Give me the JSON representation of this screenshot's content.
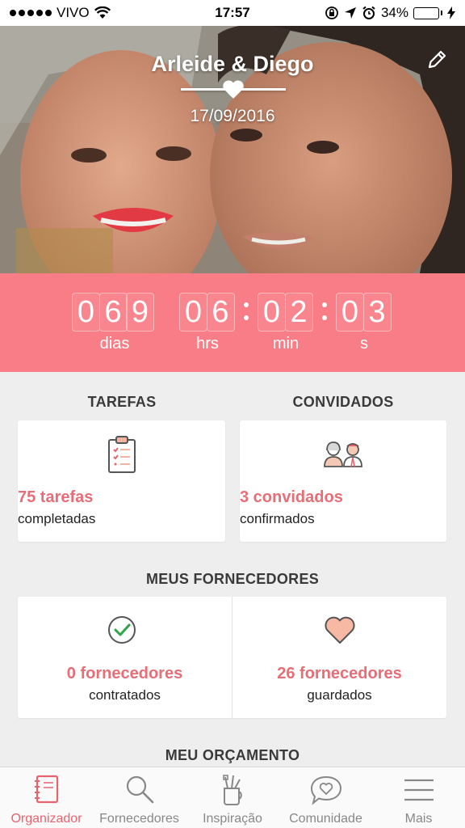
{
  "status_bar": {
    "carrier": "VIVO",
    "time": "17:57",
    "battery_percent": "34%",
    "battery_level": 0.34
  },
  "hero": {
    "title": "Arleide & Diego",
    "date": "17/09/2016"
  },
  "countdown": {
    "days_digits": [
      "0",
      "6",
      "9"
    ],
    "hours_digits": [
      "0",
      "6"
    ],
    "minutes_digits": [
      "0",
      "2"
    ],
    "seconds_digits": [
      "0",
      "3"
    ],
    "days_label": "dias",
    "hours_label": "hrs",
    "minutes_label": "min",
    "seconds_label": "s"
  },
  "tasks": {
    "title": "TAREFAS",
    "value": "75 tarefas",
    "sub": "completadas"
  },
  "guests": {
    "title": "CONVIDADOS",
    "value": "3 convidados",
    "sub": "confirmados"
  },
  "vendors": {
    "title": "MEUS FORNECEDORES",
    "hired_value": "0 fornecedores",
    "hired_sub": "contratados",
    "saved_value": "26 fornecedores",
    "saved_sub": "guardados"
  },
  "budget": {
    "title": "MEU ORÇAMENTO"
  },
  "tabs": [
    {
      "label": "Organizador",
      "icon": "notebook-icon",
      "active": true
    },
    {
      "label": "Fornecedores",
      "icon": "search-icon",
      "active": false
    },
    {
      "label": "Inspiração",
      "icon": "brushes-cup-icon",
      "active": false
    },
    {
      "label": "Comunidade",
      "icon": "chat-heart-icon",
      "active": false
    },
    {
      "label": "Mais",
      "icon": "menu-icon",
      "active": false
    }
  ],
  "colors": {
    "accent": "#f97d87",
    "accent_text": "#e76e76",
    "background": "#efeeee"
  }
}
